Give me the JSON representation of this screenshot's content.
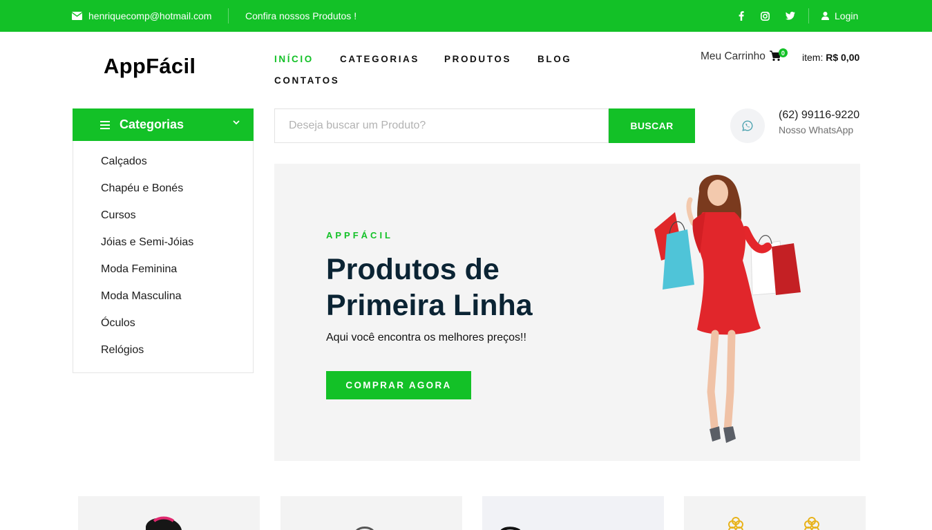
{
  "topbar": {
    "email": "henriquecomp@hotmail.com",
    "promo": "Confira nossos Produtos !",
    "social": [
      "facebook-icon",
      "instagram-icon",
      "twitter-icon"
    ],
    "login": "Login"
  },
  "header": {
    "logo": "AppFácil",
    "nav": [
      "INÍCIO",
      "CATEGORIAS",
      "PRODUTOS",
      "BLOG",
      "CONTATOS"
    ],
    "active_nav": "INÍCIO",
    "cart_label": "Meu Carrinho",
    "cart_count": "0",
    "cart_items_label": "item:",
    "cart_total": "R$ 0,00"
  },
  "categories": {
    "title": "Categorias",
    "items": [
      "Calçados",
      "Chapéu e Bonés",
      "Cursos",
      "Jóias e Semi-Jóias",
      "Moda Feminina",
      "Moda Masculina",
      "Óculos",
      "Relógios"
    ]
  },
  "search": {
    "placeholder": "Deseja buscar um Produto?",
    "button": "BUSCAR"
  },
  "contact": {
    "phone": "(62) 99116-9220",
    "label": "Nosso WhatsApp"
  },
  "hero": {
    "kicker": "APPFÁCIL",
    "title": "Produtos de Primeira Linha",
    "subtitle": "Aqui você encontra os melhores preços!!",
    "button": "COMPRAR AGORA"
  },
  "colors": {
    "brand": "#13c127",
    "heading": "#0b2434",
    "hero_bg": "#f4f4f4"
  }
}
